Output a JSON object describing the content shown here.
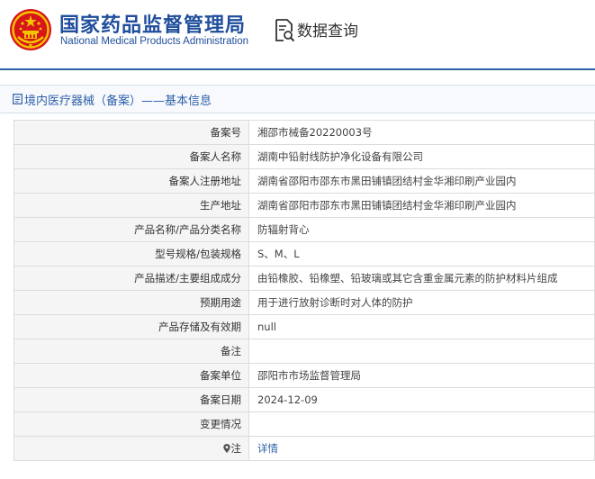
{
  "header": {
    "org_name_cn": "国家药品监督管理局",
    "org_name_en": "National Medical Products Administration",
    "query_label": "数据查询",
    "emblem_icon": "national-emblem-icon",
    "query_icon": "document-search-icon",
    "brand_color": "#1f4e9c",
    "emblem_color": "#d7151b"
  },
  "section": {
    "title": "境内医疗器械（备案）——基本信息",
    "icon": "document-icon"
  },
  "detail": {
    "rows": [
      {
        "label": "备案号",
        "value": "湘邵市械备20220003号"
      },
      {
        "label": "备案人名称",
        "value": "湖南中铅射线防护净化设备有限公司"
      },
      {
        "label": "备案人注册地址",
        "value": "湖南省邵阳市邵东市黑田铺镇团结村金华湘印刷产业园内"
      },
      {
        "label": "生产地址",
        "value": "湖南省邵阳市邵东市黑田铺镇团结村金华湘印刷产业园内"
      },
      {
        "label": "产品名称/产品分类名称",
        "value": "防辐射背心"
      },
      {
        "label": "型号规格/包装规格",
        "value": "S、M、L"
      },
      {
        "label": "产品描述/主要组成成分",
        "value": "由铅橡胶、铅橡塑、铅玻璃或其它含重金属元素的防护材料片组成"
      },
      {
        "label": "预期用途",
        "value": "用于进行放射诊断时对人体的防护"
      },
      {
        "label": "产品存储及有效期",
        "value": "null"
      },
      {
        "label": "备注",
        "value": ""
      },
      {
        "label": "备案单位",
        "value": "邵阳市市场监督管理局"
      },
      {
        "label": "备案日期",
        "value": "2024-12-09"
      },
      {
        "label": "变更情况",
        "value": ""
      }
    ],
    "note_row": {
      "label": "注",
      "icon": "map-pin-icon",
      "link_text": "详情"
    }
  }
}
